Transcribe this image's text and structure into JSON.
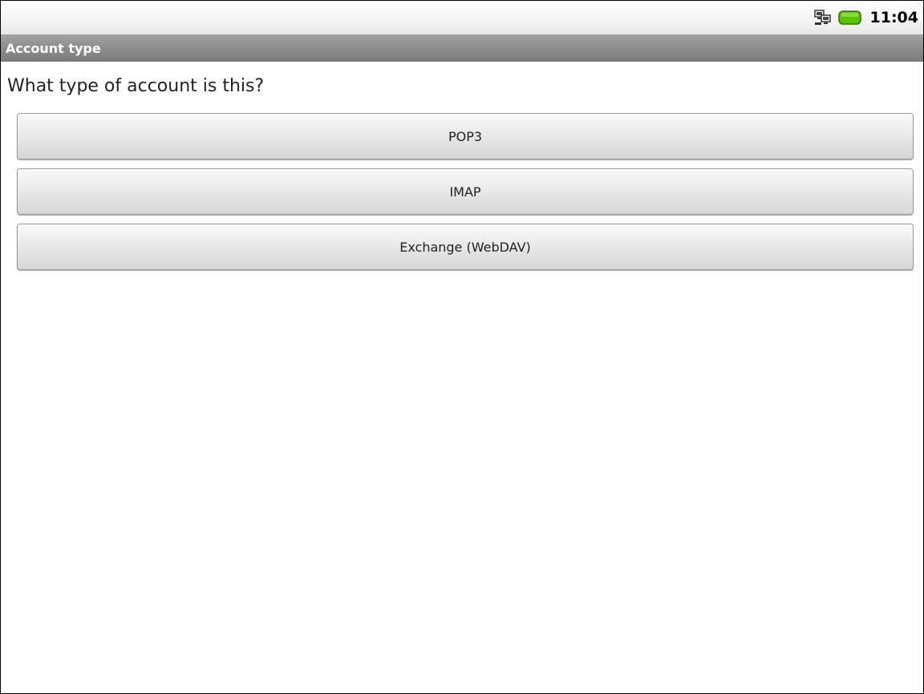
{
  "status_bar": {
    "time": "11:04",
    "icons": [
      "network-computer-icon",
      "battery-icon"
    ],
    "battery_color": "#5fc400"
  },
  "title_bar": {
    "title": "Account type"
  },
  "prompt": {
    "text": "What type of account is this?"
  },
  "account_options": [
    {
      "label": "POP3"
    },
    {
      "label": "IMAP"
    },
    {
      "label": "Exchange (WebDAV)"
    }
  ]
}
